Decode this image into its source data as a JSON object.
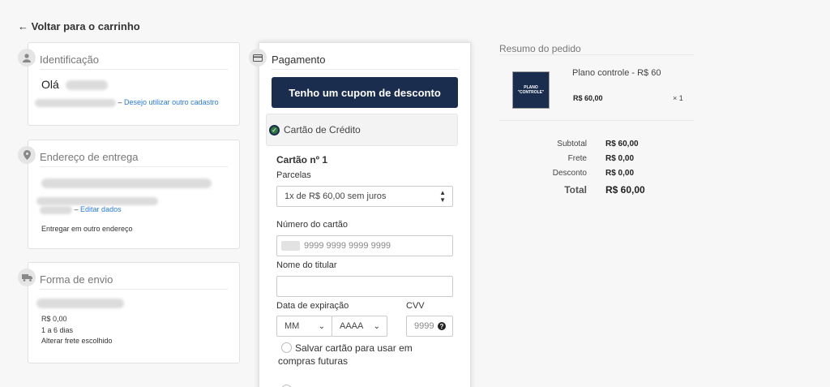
{
  "nav": {
    "back_label": "← Voltar para o carrinho"
  },
  "identification": {
    "title": "Identificação",
    "greeting": "Olá",
    "other_account_link": "Desejo utilizar outro cadastro",
    "separator": "–"
  },
  "address": {
    "title": "Endereço de entrega",
    "edit_link": "Editar dados",
    "separator": "–",
    "other_address_link": "Entregar em outro endereço"
  },
  "shipping": {
    "title": "Forma de envio",
    "price": "R$ 0,00",
    "days": "1 a 6 dias",
    "change_link": "Alterar frete escolhido"
  },
  "payment": {
    "title": "Pagamento",
    "coupon_button": "Tenho um cupom de desconto",
    "method_label": "Cartão de Crédito",
    "card_heading": "Cartão nº 1",
    "installments_label": "Parcelas",
    "installments_value": "1x de R$ 60,00 sem juros",
    "card_number_label": "Número do cartão",
    "card_number_placeholder": "9999 9999 9999 9999",
    "holder_label": "Nome do titular",
    "expiry_label": "Data de expiração",
    "month_value": "MM",
    "year_value": "AAAA",
    "cvv_label": "CVV",
    "cvv_placeholder": "9999",
    "save_card_label": "Salvar cartão para usar em compras futuras"
  },
  "summary": {
    "title": "Resumo do pedido",
    "product": {
      "name": "Plano controle - R$ 60",
      "thumb_line1": "PLANO",
      "thumb_line2": "\"CONTROLE\"",
      "price": "R$ 60,00",
      "qty": "× 1"
    },
    "rows": [
      {
        "label": "Subtotal",
        "value": "R$ 60,00"
      },
      {
        "label": "Frete",
        "value": "R$ 0,00"
      },
      {
        "label": "Desconto",
        "value": "R$ 0,00"
      }
    ],
    "total": {
      "label": "Total",
      "value": "R$ 60,00"
    }
  },
  "colors": {
    "primary": "#1b2d4e",
    "link": "#2a7ad6",
    "check": "#2d7a3a"
  },
  "icons": [
    "user-icon",
    "location-pin-icon",
    "truck-icon",
    "credit-card-icon",
    "question-icon"
  ]
}
